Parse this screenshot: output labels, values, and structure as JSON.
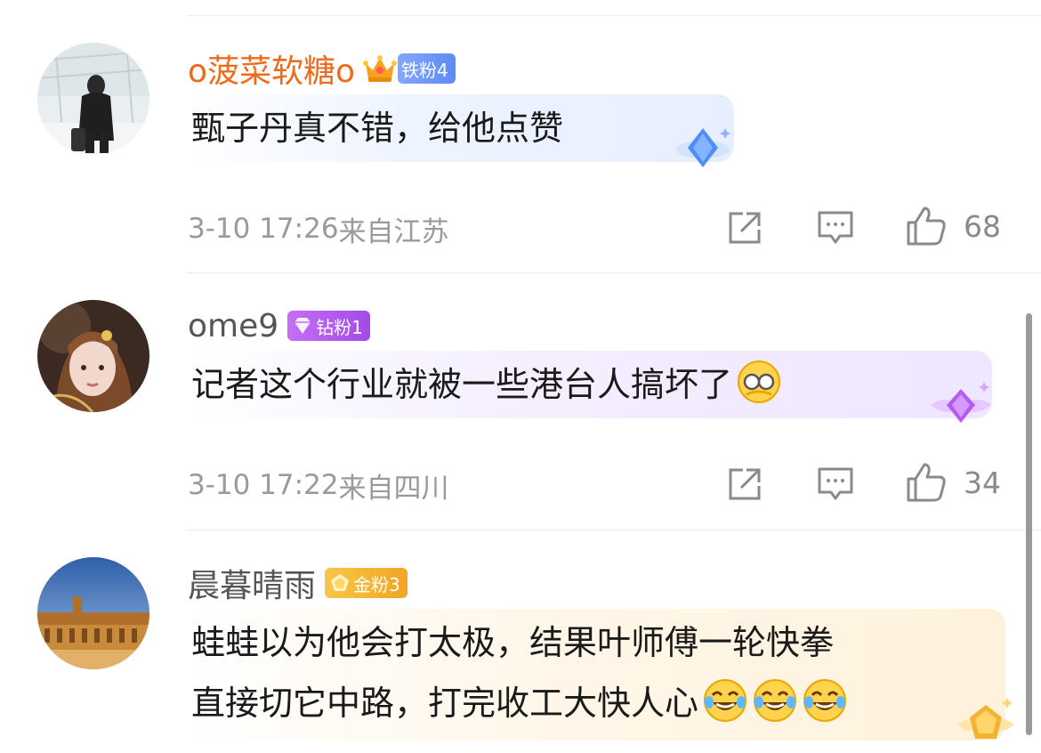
{
  "comments": [
    {
      "username": "o菠菜软糖o",
      "badge": "铁粉4",
      "text_lines": [
        "甄子丹真不错，给他点赞"
      ],
      "time": "3-10 17:26",
      "location": "来自江苏",
      "likes": "68"
    },
    {
      "username": "ome9",
      "badge": "钻粉1",
      "text_lines": [
        "记者这个行业就被一些港台人搞坏了"
      ],
      "time": "3-10 17:22",
      "location": "来自四川",
      "likes": "34"
    },
    {
      "username": "晨暮晴雨",
      "badge": "金粉3",
      "text_lines": [
        "蛙蛙以为他会打太极，结果叶师傅一轮快拳",
        "直接切它中路，打完收工大快人心"
      ],
      "time": "",
      "location": "",
      "likes": ""
    }
  ],
  "icons": {
    "share": "share-icon",
    "comment": "comment-icon",
    "like": "thumbs-up-icon"
  },
  "colors": {
    "vip_name": "#f06a1a",
    "iron_badge": "#6f98f8",
    "diamond_badge": "#b35cef",
    "gold_badge": "#f4b232"
  }
}
